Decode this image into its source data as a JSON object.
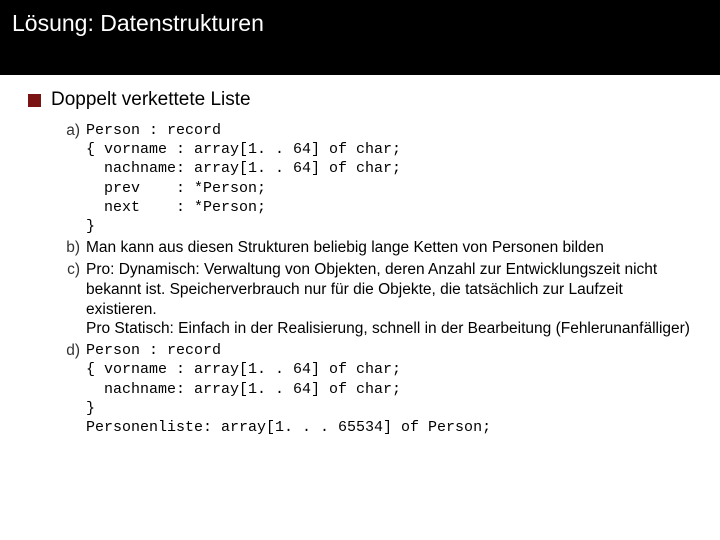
{
  "header": {
    "title": "Lösung: Datenstrukturen"
  },
  "main": {
    "bullet": "Doppelt verkettete Liste",
    "items": [
      {
        "label": "a)",
        "kind": "code",
        "lines": [
          "Person : record",
          "{ vorname : array[1. . 64] of char;",
          "  nachname: array[1. . 64] of char;",
          "  prev    : *Person;",
          "  next    : *Person;",
          "}"
        ]
      },
      {
        "label": "b)",
        "kind": "text",
        "text": "Man kann aus diesen Strukturen beliebig lange Ketten von Personen bilden"
      },
      {
        "label": "c)",
        "kind": "text",
        "text": "Pro: Dynamisch: Verwaltung von Objekten, deren Anzahl zur Entwicklungszeit nicht bekannt ist. Speicherverbrauch nur für die Objekte, die tatsächlich zur Laufzeit existieren.\nPro Statisch: Einfach in der Realisierung, schnell in der Bearbeitung (Fehlerunanfälliger)"
      },
      {
        "label": "d)",
        "kind": "code",
        "lines": [
          "Person : record",
          "{ vorname : array[1. . 64] of char;",
          "  nachname: array[1. . 64] of char;",
          "}",
          "Personenliste: array[1. . . 65534] of Person;"
        ]
      }
    ]
  }
}
